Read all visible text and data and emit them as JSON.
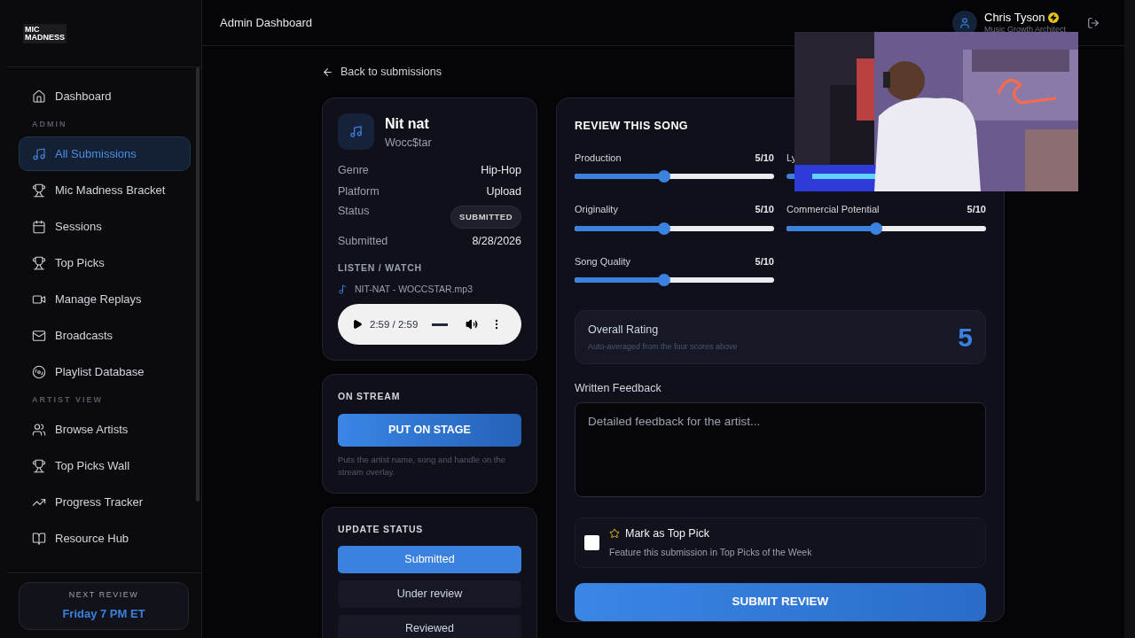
{
  "header": {
    "title": "Admin Dashboard",
    "user": {
      "name": "Chris Tyson",
      "role": "Music Growth Architect"
    }
  },
  "sidebar": {
    "logo": [
      "MIC",
      "MADNESS"
    ],
    "sections": [
      {
        "items": [
          {
            "label": "Dashboard",
            "selected": false
          }
        ]
      },
      {
        "heading": "ADMIN",
        "items": [
          {
            "label": "All Submissions",
            "selected": true
          },
          {
            "label": "Mic Madness Bracket",
            "selected": false
          },
          {
            "label": "Sessions",
            "selected": false
          },
          {
            "label": "Top Picks",
            "selected": false
          },
          {
            "label": "Manage Replays",
            "selected": false
          },
          {
            "label": "Broadcasts",
            "selected": false
          },
          {
            "label": "Playlist Database",
            "selected": false
          }
        ]
      },
      {
        "heading": "ARTIST VIEW",
        "items": [
          {
            "label": "Browse Artists",
            "selected": false
          },
          {
            "label": "Top Picks Wall",
            "selected": false
          },
          {
            "label": "Progress Tracker",
            "selected": false
          },
          {
            "label": "Resource Hub",
            "selected": false
          }
        ]
      }
    ],
    "next_review": {
      "label": "NEXT REVIEW",
      "value": "Friday 7 PM ET"
    }
  },
  "back_link": "Back to submissions",
  "song": {
    "title": "Nit nat",
    "artist": "Wocc$tar",
    "details": [
      {
        "label": "Genre",
        "value": "Hip-Hop",
        "kind": "text"
      },
      {
        "label": "Platform",
        "value": "Upload",
        "kind": "text"
      },
      {
        "label": "Status",
        "value": "SUBMITTED",
        "kind": "badge"
      },
      {
        "label": "Submitted",
        "value": "8/28/2026",
        "kind": "text"
      }
    ],
    "media_heading": "LISTEN / WATCH",
    "file": "NIT-NAT - WOCCSTAR.mp3",
    "player": {
      "time": "2:59 / 2:59"
    }
  },
  "stream": {
    "heading": "ON STREAM",
    "button": "PUT ON STAGE",
    "note": "Puts the artist name, song and handle on the stream overlay."
  },
  "update_status": {
    "heading": "UPDATE STATUS",
    "options": [
      {
        "label": "Submitted",
        "selected": true
      },
      {
        "label": "Under review",
        "selected": false
      },
      {
        "label": "Reviewed",
        "selected": false
      }
    ]
  },
  "review": {
    "heading": "REVIEW THIS SONG",
    "scores": [
      {
        "label": "Production",
        "value": "5/10",
        "level": 0.45
      },
      {
        "label": "Ly"
      },
      {
        "label": "Originality",
        "value": "5/10",
        "level": 0.45
      },
      {
        "label": "Commercial Potential",
        "value": "5/10",
        "level": 0.45
      },
      {
        "label": "Song Quality",
        "value": "5/10",
        "level": 0.45
      }
    ],
    "overall": {
      "label": "Overall Rating",
      "note": "Auto-averaged from the four scores above",
      "value": "5"
    },
    "feedback": {
      "label": "Written Feedback",
      "placeholder": "Detailed feedback for the artist..."
    },
    "top_pick": {
      "checked": false,
      "label": "Mark as Top Pick",
      "note": "Feature this submission in Top Picks of the Week"
    },
    "submit": "SUBMIT REVIEW"
  }
}
